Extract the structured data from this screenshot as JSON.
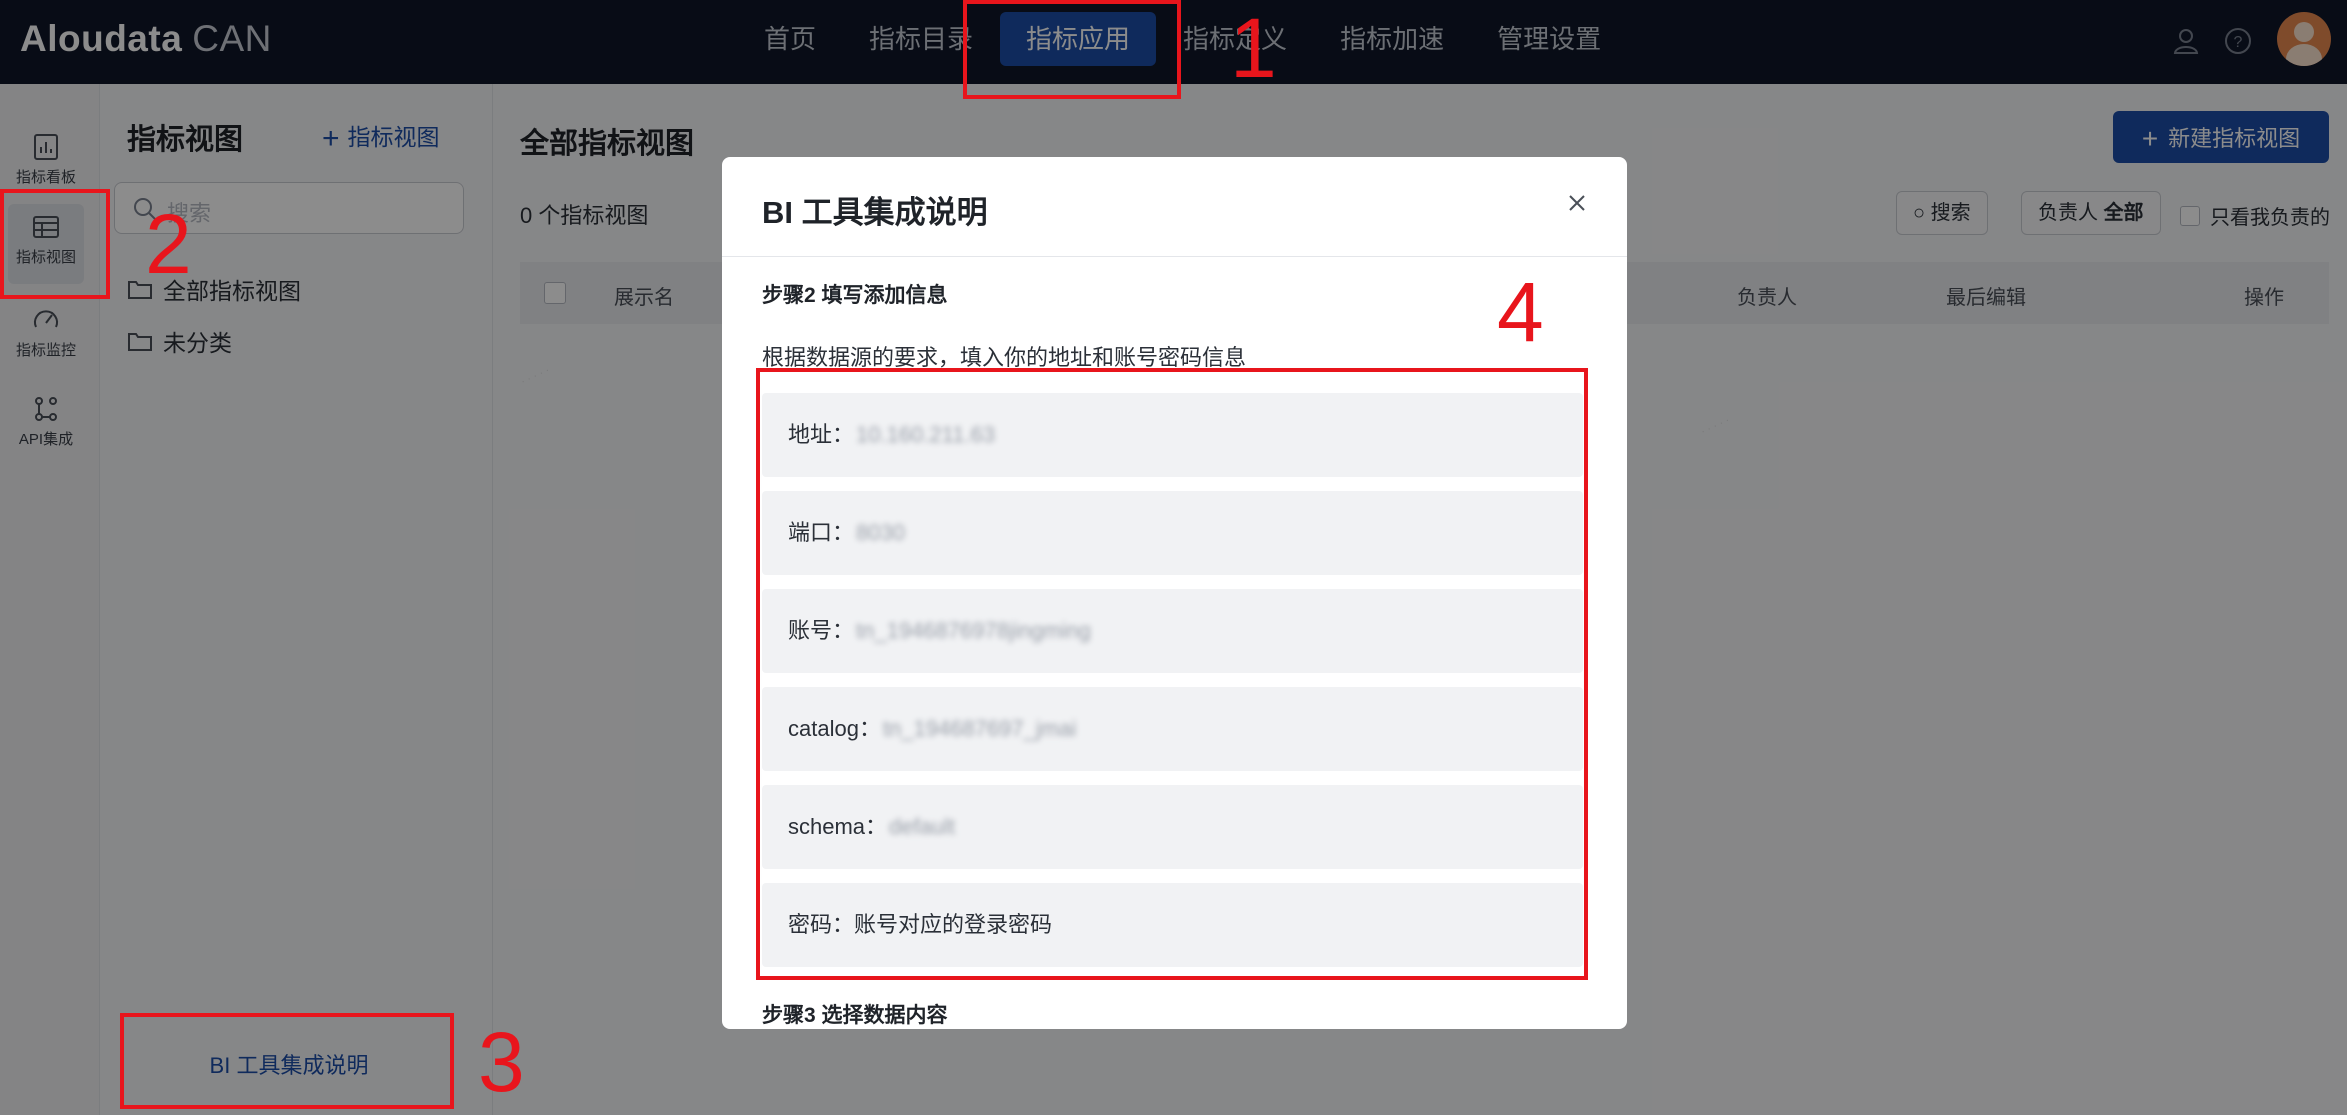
{
  "app": {
    "logo_bold": "Aloudata",
    "logo_light": "CAN"
  },
  "nav": {
    "items": [
      "首页",
      "指标目录",
      "指标应用",
      "指标定义",
      "指标加速",
      "管理设置"
    ],
    "active": "指标应用"
  },
  "rail": {
    "items": [
      {
        "label": "指标看板",
        "icon": "chart-icon"
      },
      {
        "label": "指标视图",
        "icon": "table-icon"
      },
      {
        "label": "指标监控",
        "icon": "gauge-icon"
      },
      {
        "label": "API集成",
        "icon": "api-icon"
      }
    ]
  },
  "view_panel": {
    "title": "指标视图",
    "add_label": "指标视图",
    "search_placeholder": "搜索",
    "folders": [
      "全部指标视图",
      "未分类"
    ],
    "bi_button": "BI 工具集成说明"
  },
  "main": {
    "title": "全部指标视图",
    "count": "0 个指标视图",
    "new_button": "新建指标视图",
    "search_button": "搜索",
    "owner_filter_label": "负责人",
    "owner_filter_value": "全部",
    "only_mine": "只看我负责的",
    "columns": [
      "展示名",
      "负责人",
      "最后编辑",
      "操作"
    ]
  },
  "modal": {
    "title": "BI 工具集成说明",
    "step2": "步骤2 填写添加信息",
    "desc": "根据数据源的要求，填入你的地址和账号密码信息",
    "fields": [
      {
        "label": "地址：",
        "value": "10.160.211.63"
      },
      {
        "label": "端口：",
        "value": "8030"
      },
      {
        "label": "账号：",
        "value": "tn_1946876978jingming"
      },
      {
        "label": "catalog：",
        "value": "tn_19468769​7_jmai"
      },
      {
        "label": "schema：",
        "value": "default"
      },
      {
        "label": "密码：",
        "value": "账号对应的登录密码"
      }
    ],
    "step3": "步骤3 选择数据内容"
  },
  "annotations": {
    "numbers": [
      "1",
      "2",
      "3",
      "4"
    ],
    "color": "#e8151c"
  },
  "colors": {
    "topbar": "#0f1729",
    "accent": "#1d4ea8"
  }
}
